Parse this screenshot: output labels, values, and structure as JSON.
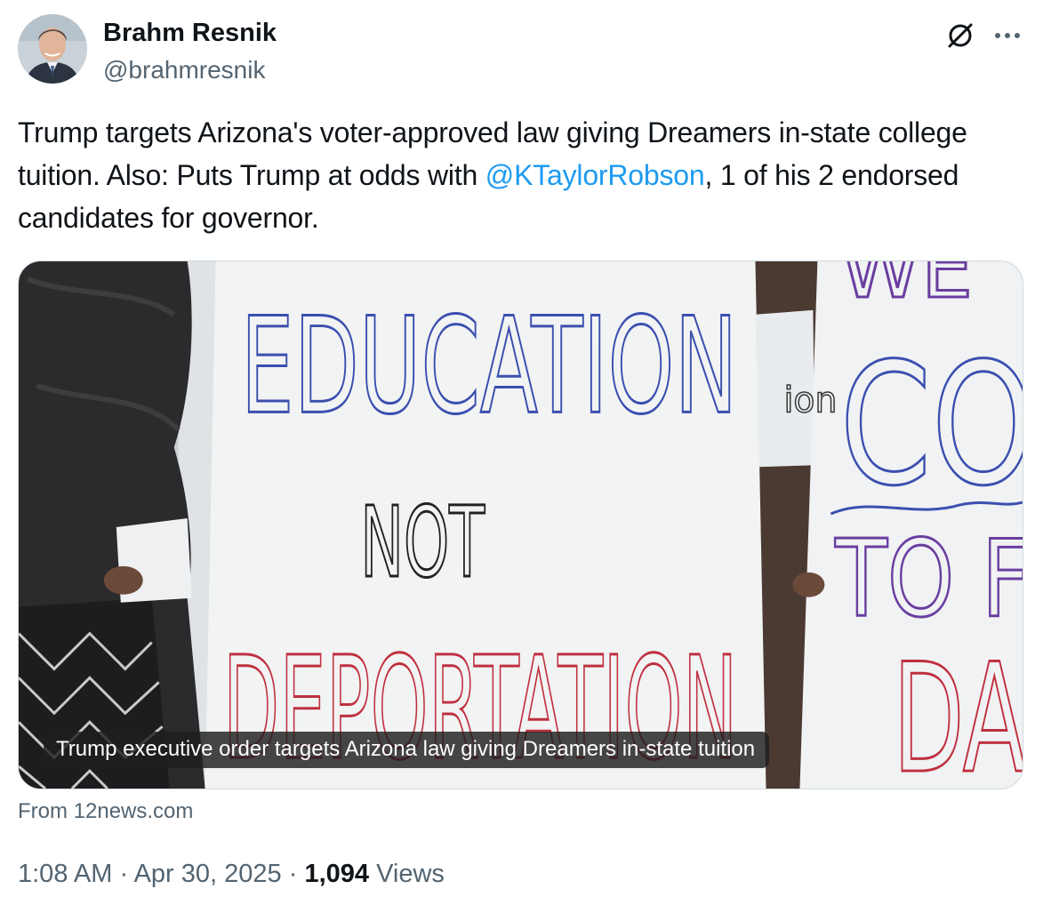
{
  "author": {
    "display_name": "Brahm Resnik",
    "handle": "@brahmresnik"
  },
  "tweet": {
    "text_1": "Trump targets Arizona's voter-approved law giving Dreamers in-state college tuition. Also: Puts Trump at odds with ",
    "mention": "@KTaylorRobson",
    "text_2": ", 1 of his 2 endorsed candidates for governor."
  },
  "media": {
    "caption": "Trump executive order targets Arizona law giving Dreamers in-state tuition",
    "source": "From 12news.com",
    "sign_text": {
      "left_line_1": "EDUCATION",
      "left_line_2": "NOT",
      "left_line_3": "DEPORTATION",
      "middle_fragment": "ion",
      "right_line_1": "WE",
      "right_line_2": "CO",
      "right_line_3": "TO F",
      "right_line_4": "DA"
    }
  },
  "meta": {
    "time": "1:08 AM",
    "separator": " · ",
    "date": "Apr 30, 2025",
    "views_count": "1,094",
    "views_label": " Views"
  },
  "icons": {
    "grok": "grok-icon",
    "more": "more-icon"
  },
  "colors": {
    "accent": "#1d9bf0",
    "text_primary": "#0f1419",
    "text_secondary": "#536471",
    "sign_blue": "#3b4fb0",
    "sign_red": "#c0303f"
  }
}
